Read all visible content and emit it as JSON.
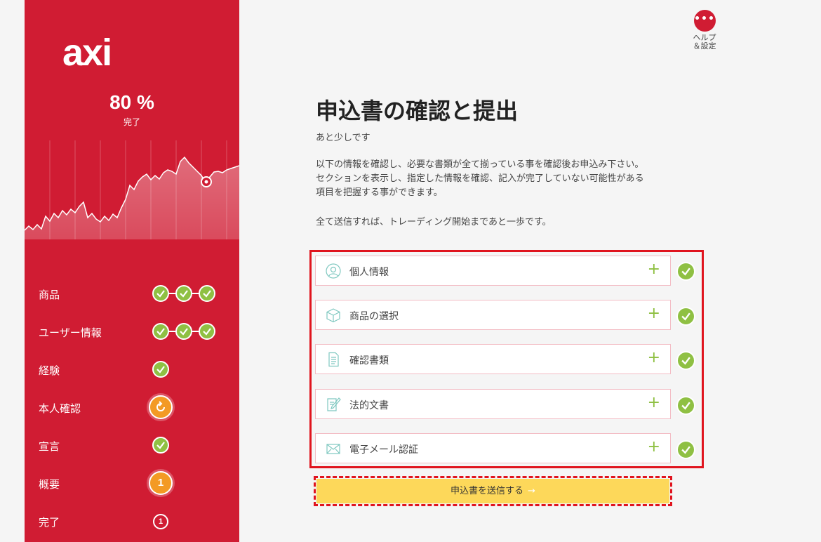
{
  "sidebar": {
    "logo": "axi",
    "progress_percent": "80 %",
    "progress_label": "完了",
    "steps": [
      {
        "label": "商品",
        "status": "complete",
        "substeps": 3
      },
      {
        "label": "ユーザー情報",
        "status": "complete",
        "substeps": 3
      },
      {
        "label": "経験",
        "status": "complete",
        "substeps": 1
      },
      {
        "label": "本人確認",
        "status": "in-progress"
      },
      {
        "label": "宣言",
        "status": "complete",
        "substeps": 1
      },
      {
        "label": "概要",
        "status": "current",
        "number": "1"
      },
      {
        "label": "完了",
        "status": "pending",
        "number": "1"
      }
    ]
  },
  "help": {
    "icon_text": "•••",
    "label_line1": "ヘルプ",
    "label_line2": "＆設定"
  },
  "main": {
    "title": "申込書の確認と提出",
    "subtitle": "あと少しです",
    "description_lines": [
      "以下の情報を確認し、必要な書類が全て揃っている事を確認後お申込み下さい。",
      "セクションを表示し、指定した情報を確認、記入が完了していない可能性がある",
      "項目を把握する事ができます。"
    ],
    "description_2": "全て送信すれば、トレーディング開始まであと一歩です。",
    "sections": [
      {
        "label": "個人情報",
        "icon": "user-icon",
        "plus": "+",
        "status": "complete"
      },
      {
        "label": "商品の選択",
        "icon": "box-icon",
        "plus": "+",
        "status": "complete"
      },
      {
        "label": "確認書類",
        "icon": "document-icon",
        "plus": "+",
        "status": "complete"
      },
      {
        "label": "法的文書",
        "icon": "pen-document-icon",
        "plus": "+",
        "status": "complete"
      },
      {
        "label": "電子メール認証",
        "icon": "envelope-icon",
        "plus": "+",
        "status": "complete"
      }
    ],
    "submit_label": "申込書を送信する",
    "submit_arrow": "→"
  },
  "colors": {
    "brand_red": "#d01c33",
    "check_green": "#8fc043",
    "progress_orange": "#f39a24",
    "submit_yellow": "#fdd85a",
    "highlight_red": "#e0141e"
  }
}
